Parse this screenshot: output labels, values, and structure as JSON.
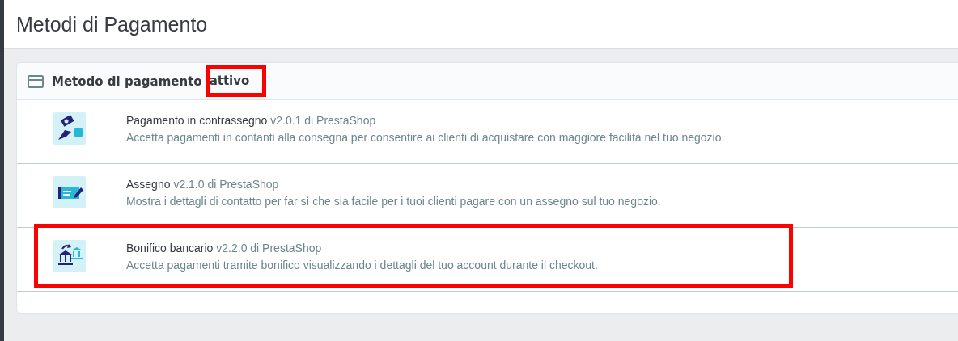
{
  "page_title": "Metodi di Pagamento",
  "card": {
    "title": "Metodo di pagamento",
    "title_highlighted_word": "attivo",
    "methods": [
      {
        "kind": "cash",
        "name": "Pagamento in contrassegno",
        "version": "v2.0.1 di PrestaShop",
        "description": "Accetta pagamenti in contanti alla consegna per consentire ai clienti di acquistare con maggiore facilità nel tuo negozio.",
        "highlighted": false
      },
      {
        "kind": "check",
        "name": "Assegno",
        "version": "v2.1.0 di PrestaShop",
        "description": "Mostra i dettagli di contatto per far sì che sia facile per i tuoi clienti pagare con un assegno sul tuo negozio.",
        "highlighted": false
      },
      {
        "kind": "bank",
        "name": "Bonifico bancario",
        "version": "v2.2.0 di PrestaShop",
        "description": "Accetta pagamenti tramite bonifico visualizzando i dettagli del tuo account durante il checkout.",
        "highlighted": true
      }
    ]
  }
}
